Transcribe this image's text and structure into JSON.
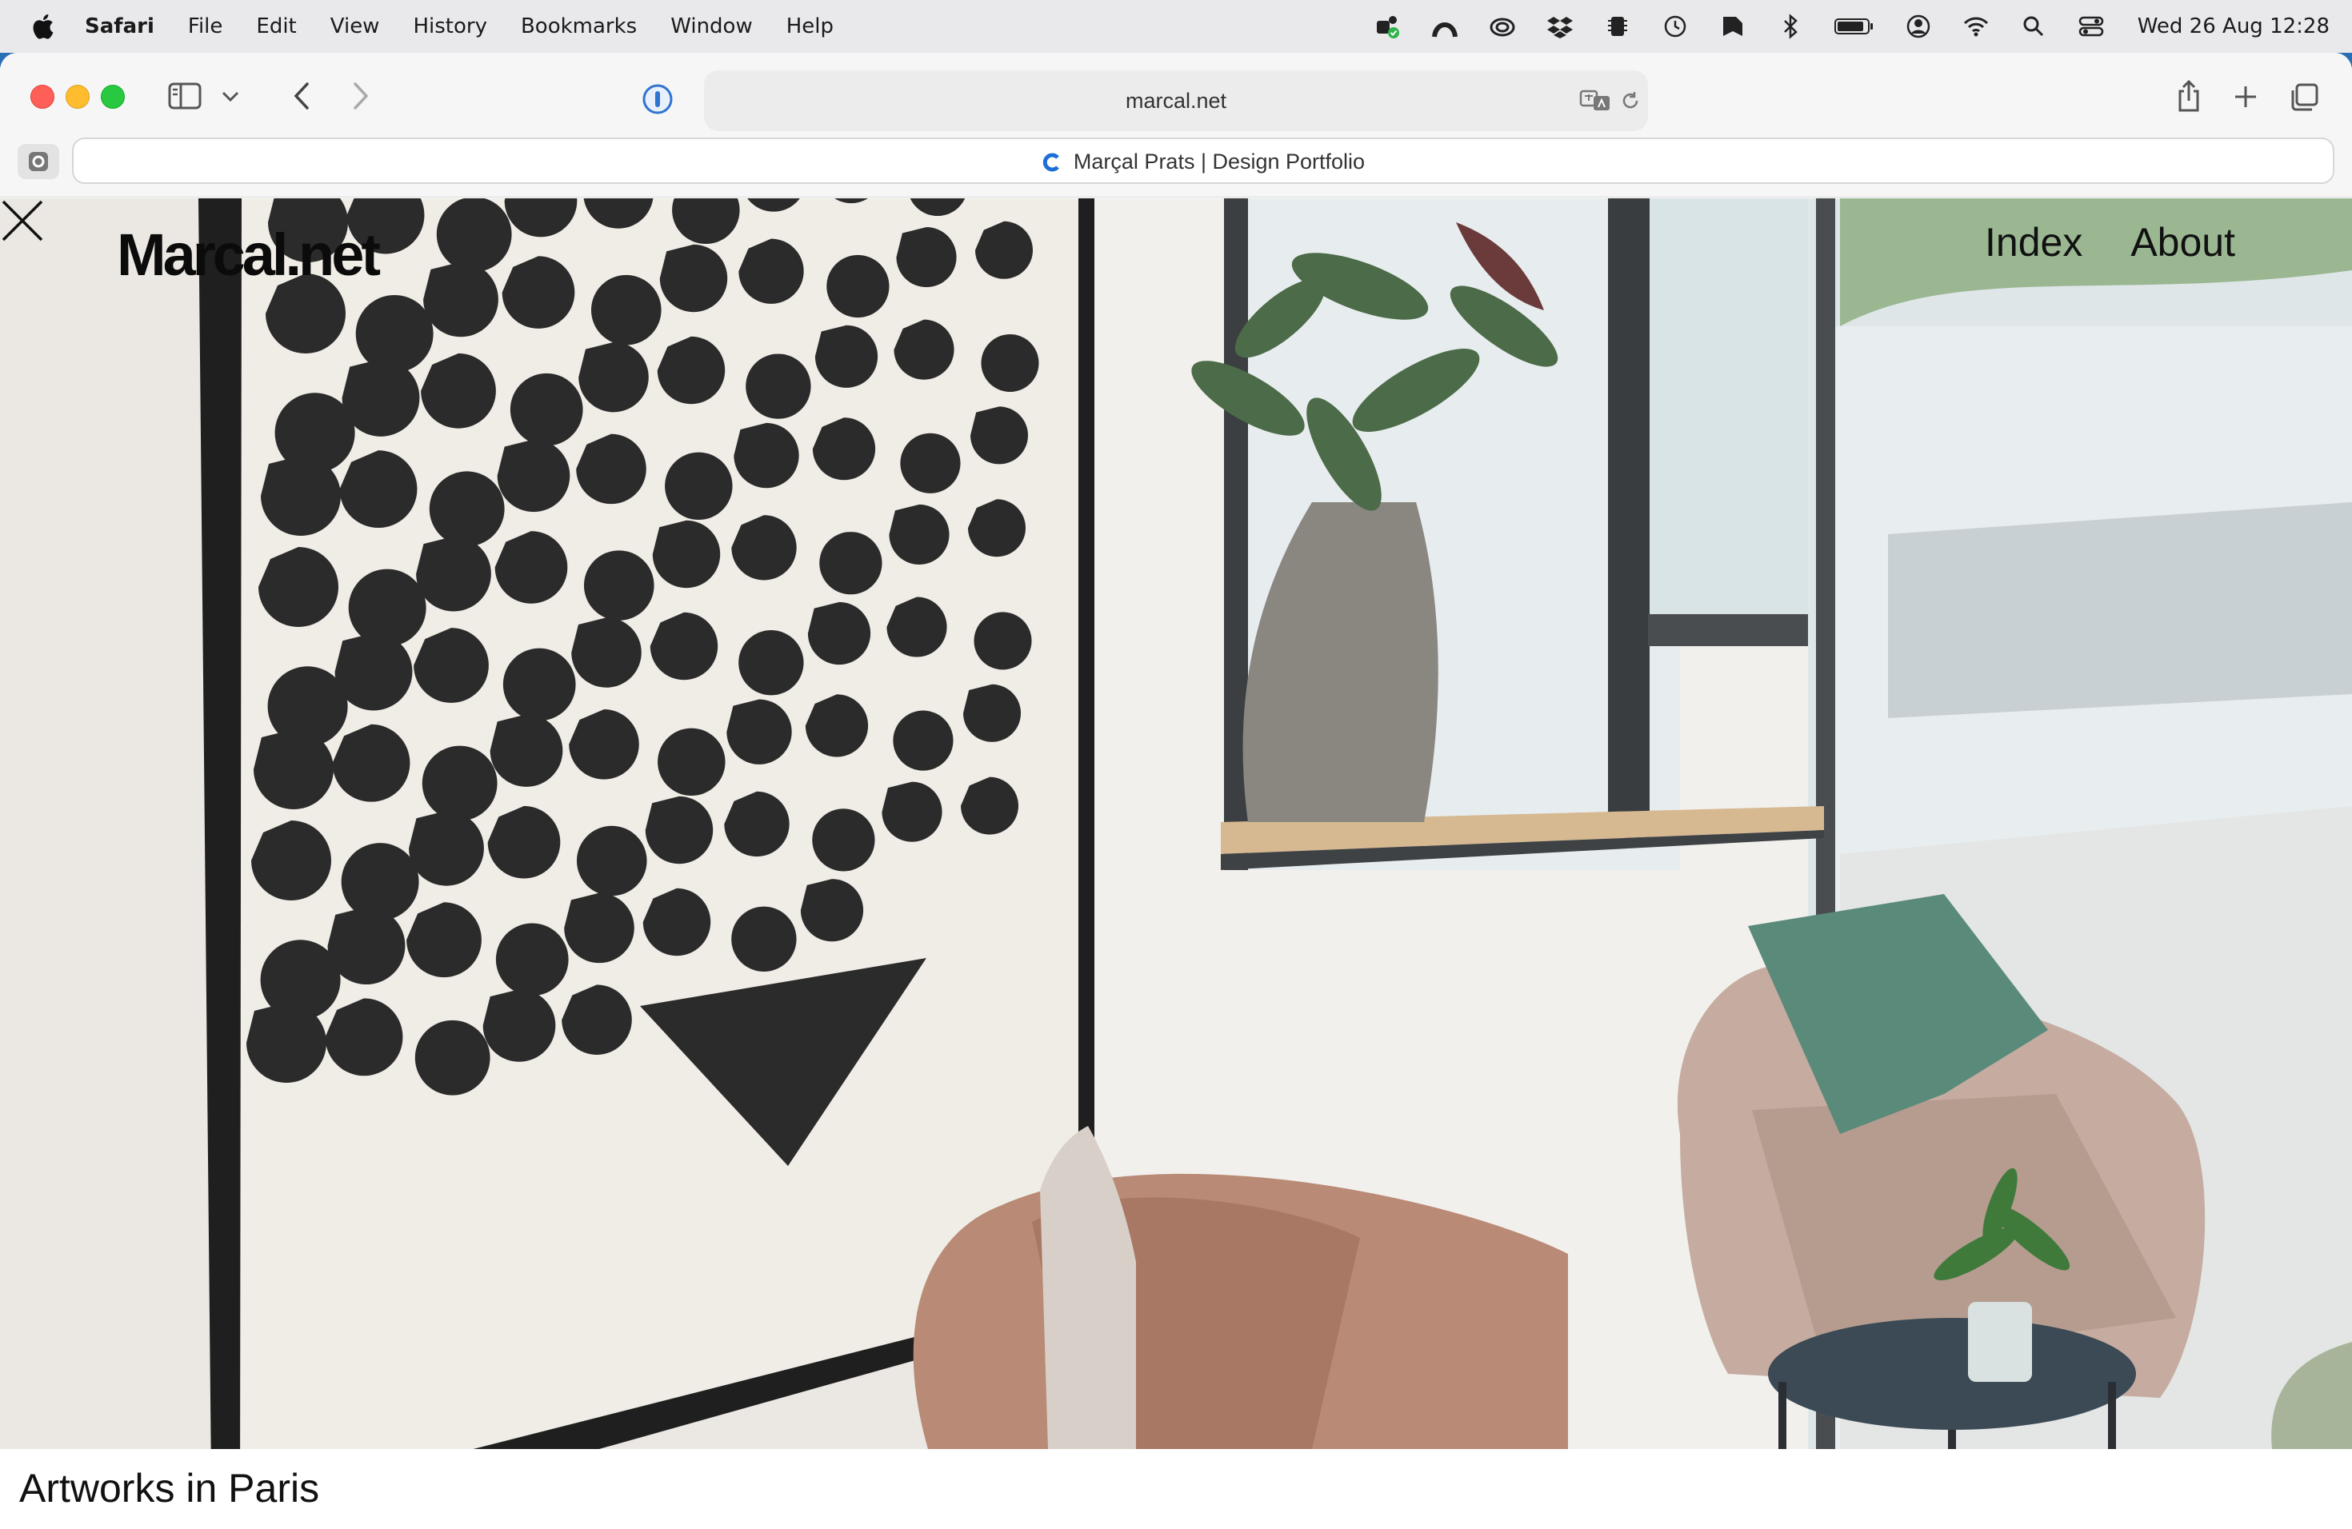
{
  "menubar": {
    "app_name": "Safari",
    "items": [
      "File",
      "Edit",
      "View",
      "History",
      "Bookmarks",
      "Window",
      "Help"
    ],
    "clock": "Wed 26 Aug  12:28",
    "status_icons": [
      "teams-icon",
      "arc-icon",
      "creative-cloud-icon",
      "dropbox-icon",
      "memory-chip-icon",
      "time-machine-icon",
      "tag-icon",
      "bluetooth-icon",
      "battery-icon",
      "user-icon",
      "wifi-icon",
      "spotlight-icon",
      "control-center-icon"
    ]
  },
  "browser": {
    "url": "marcal.net",
    "tab_title": "Marçal Prats | Design Portfolio"
  },
  "site": {
    "logo": "Marcal.net",
    "nav": [
      "Index",
      "About"
    ],
    "caption": "Artworks in Paris"
  },
  "colors": {
    "menubar_bg": "#e9e9ec",
    "wall": "#ece9e4",
    "artwork_ink": "#2b2b2b",
    "chair": "#b98a76",
    "cushion": "#5a8a7a"
  }
}
